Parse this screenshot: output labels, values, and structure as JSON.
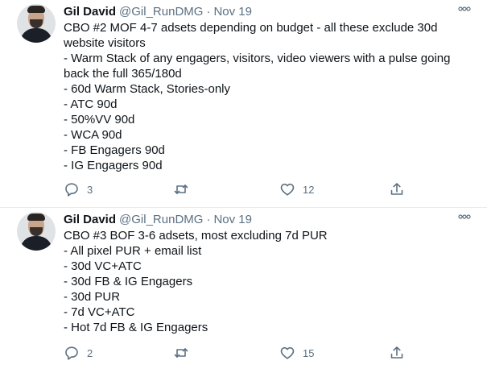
{
  "tweets": [
    {
      "author_name": "Gil David",
      "handle": "@Gil_RunDMG",
      "separator": "·",
      "date": "Nov 19",
      "lines": [
        "CBO #2 MOF 4-7 adsets depending on budget - all these exclude 30d",
        "website visitors",
        "- Warm Stack of any engagers, visitors, video viewers with a pulse going",
        "back the full 365/180d",
        "- 60d Warm Stack, Stories-only",
        "- ATC 90d",
        "- 50%VV 90d",
        "- WCA 90d",
        "- FB Engagers 90d",
        "- IG Engagers 90d"
      ],
      "reply_count": "3",
      "retweet_count": "",
      "like_count": "12"
    },
    {
      "author_name": "Gil David",
      "handle": "@Gil_RunDMG",
      "separator": "·",
      "date": "Nov 19",
      "lines": [
        "CBO #3 BOF 3-6 adsets, most excluding 7d PUR",
        "- All pixel PUR + email list",
        "- 30d VC+ATC",
        "- 30d FB & IG Engagers",
        "- 30d PUR",
        "- 7d VC+ATC",
        "- Hot 7d FB & IG Engagers"
      ],
      "reply_count": "2",
      "retweet_count": "",
      "like_count": "15"
    }
  ],
  "colors": {
    "text": "#0f1419",
    "secondary": "#5b7083",
    "divider": "#e6ecf0",
    "background": "#ffffff"
  },
  "icons": {
    "avatar": "profile-photo",
    "more": "more-dots-icon",
    "reply": "reply-icon",
    "retweet": "retweet-icon",
    "like": "heart-icon",
    "share": "share-icon"
  }
}
